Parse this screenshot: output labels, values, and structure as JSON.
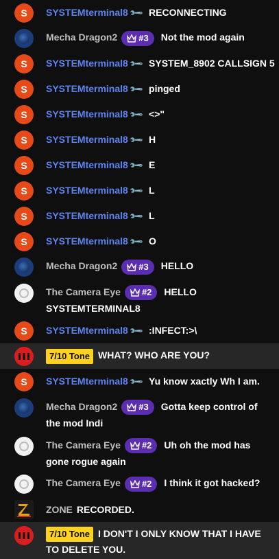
{
  "messages": [
    {
      "avatar": "S",
      "author": "SYSTEMterminal8",
      "text": "RECONNECTING"
    },
    {
      "author": "Mecha Dragon2",
      "badge": "#3",
      "text": "Not the mod again"
    },
    {
      "avatar": "S",
      "author": "SYSTEMterminal8",
      "text": "SYSTEM_8902 CALLSIGN 5"
    },
    {
      "avatar": "S",
      "author": "SYSTEMterminal8",
      "text": "pinged"
    },
    {
      "avatar": "S",
      "author": "SYSTEMterminal8",
      "text": "<>\""
    },
    {
      "avatar": "S",
      "author": "SYSTEMterminal8",
      "text": "H"
    },
    {
      "avatar": "S",
      "author": "SYSTEMterminal8",
      "text": "E"
    },
    {
      "avatar": "S",
      "author": "SYSTEMterminal8",
      "text": "L"
    },
    {
      "avatar": "S",
      "author": "SYSTEMterminal8",
      "text": "L"
    },
    {
      "avatar": "S",
      "author": "SYSTEMterminal8",
      "text": "O"
    },
    {
      "author": "Mecha Dragon2",
      "badge": "#3",
      "text": "HELLO"
    },
    {
      "author": "The Camera Eye",
      "badge": "#2",
      "text": "HELLO SYSTEMTERMINAL8"
    },
    {
      "avatar": "S",
      "author": "SYSTEMterminal8",
      "text": ":INFECT:>\\"
    },
    {
      "tone": "7/10 Tone",
      "text": "WHAT? WHO ARE YOU?"
    },
    {
      "avatar": "S",
      "author": "SYSTEMterminal8",
      "text": "Yu know xactly Wh I am."
    },
    {
      "author": "Mecha Dragon2",
      "badge": "#3",
      "text": "Gotta keep control of the mod Indi"
    },
    {
      "author": "The Camera Eye",
      "badge": "#2",
      "text": "Uh oh the mod has gone rogue again"
    },
    {
      "author": "The Camera Eye",
      "badge": "#2",
      "text": "I think it got hacked?"
    },
    {
      "author": "ZONE",
      "text": "RECORDED."
    },
    {
      "tone": "7/10 Tone",
      "text": "I DON'T I ONLY KNOW THAT I HAVE TO DELETE YOU."
    }
  ],
  "colors": {
    "background": "#0f0f0f",
    "system_name": "#5e84f1",
    "badge": "#5b2db0",
    "tone_badge": "#ffd21f",
    "highlight_row": "#272727"
  }
}
